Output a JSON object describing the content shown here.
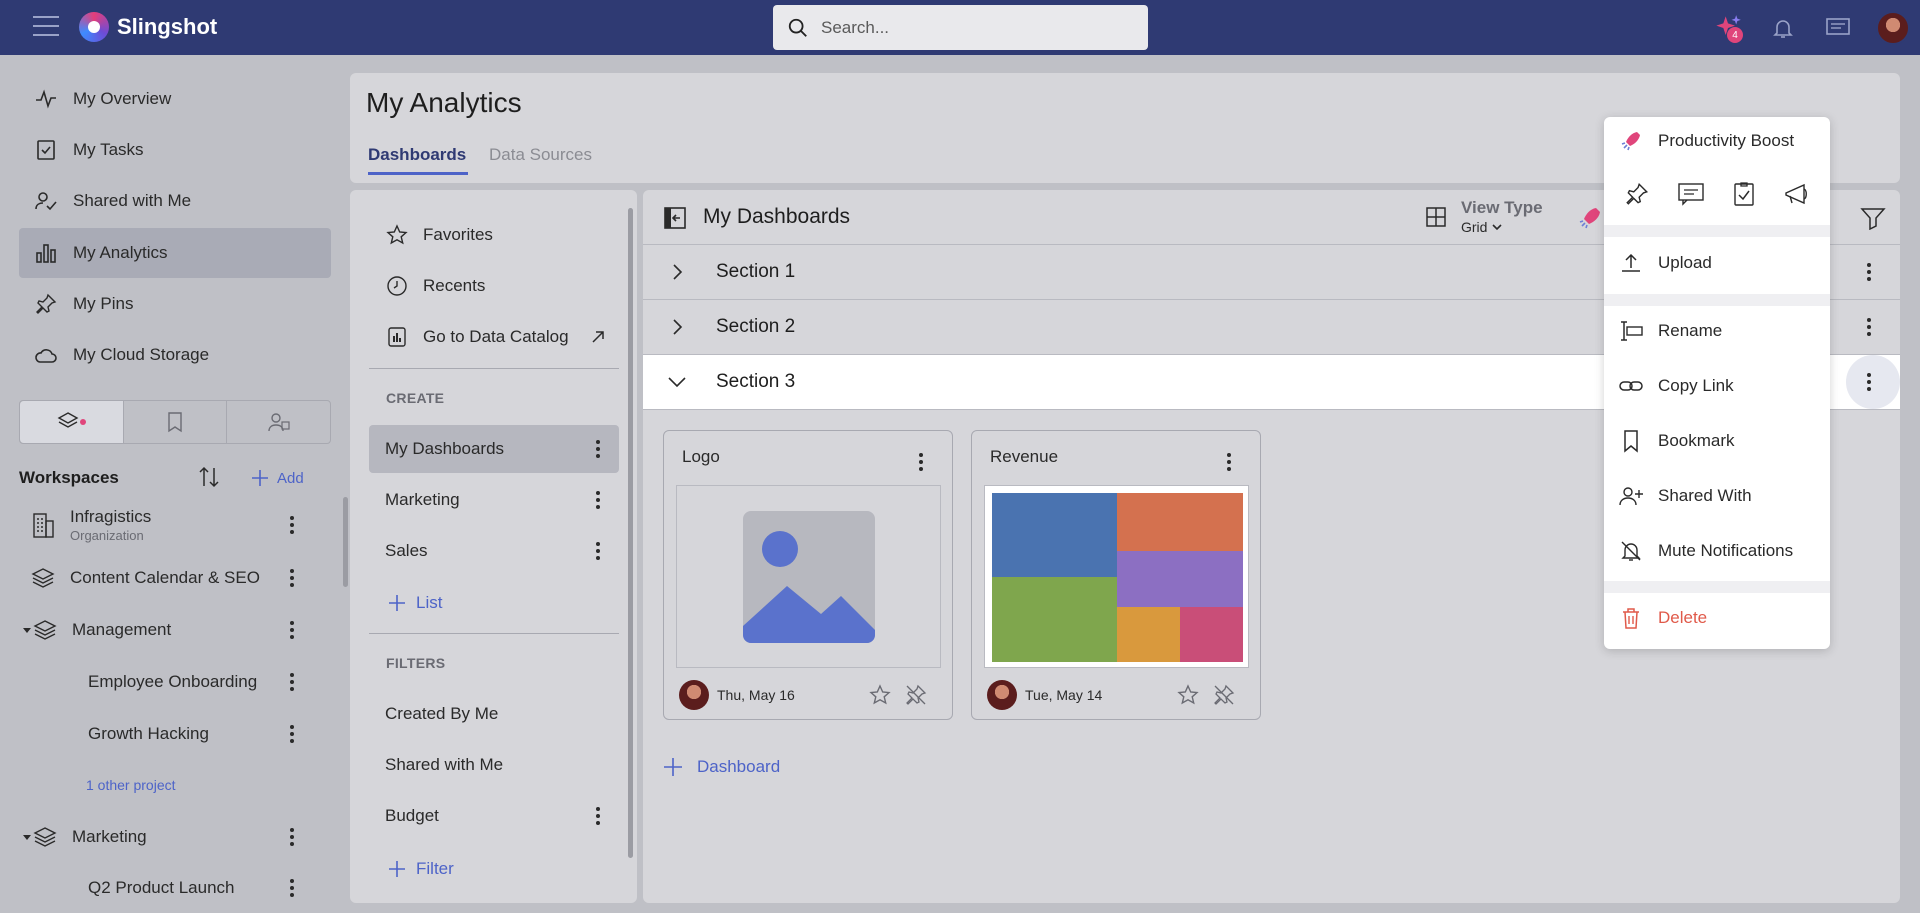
{
  "app": {
    "name": "Slingshot"
  },
  "search": {
    "placeholder": "Search..."
  },
  "topbar": {
    "ai_badge": "4"
  },
  "sidebar": {
    "items": [
      {
        "label": "My Overview"
      },
      {
        "label": "My Tasks"
      },
      {
        "label": "Shared with Me"
      },
      {
        "label": "My Analytics"
      },
      {
        "label": "My Pins"
      },
      {
        "label": "My Cloud Storage"
      }
    ],
    "workspaces_title": "Workspaces",
    "add_label": "Add",
    "workspaces": [
      {
        "label": "Infragistics",
        "sub": "Organization"
      },
      {
        "label": "Content Calendar & SEO"
      },
      {
        "label": "Management"
      },
      {
        "label": "Employee Onboarding"
      },
      {
        "label": "Growth Hacking"
      },
      {
        "label": "Marketing"
      },
      {
        "label": "Q2 Product Launch"
      }
    ],
    "other_projects": "1 other project"
  },
  "main": {
    "title": "My Analytics",
    "tabs": [
      {
        "label": "Dashboards"
      },
      {
        "label": "Data Sources"
      }
    ]
  },
  "panel": {
    "top": [
      {
        "label": "Favorites"
      },
      {
        "label": "Recents"
      },
      {
        "label": "Go to Data Catalog"
      }
    ],
    "create_label": "CREATE",
    "create": [
      {
        "label": "My Dashboards"
      },
      {
        "label": "Marketing"
      },
      {
        "label": "Sales"
      }
    ],
    "add_list": "List",
    "filters_label": "FILTERS",
    "filters": [
      {
        "label": "Created By Me"
      },
      {
        "label": "Shared with Me"
      },
      {
        "label": "Budget"
      }
    ],
    "add_filter": "Filter"
  },
  "dashboards": {
    "title": "My Dashboards",
    "view_type_label": "View Type",
    "view_type_value": "Grid",
    "sections": [
      {
        "label": "Section 1"
      },
      {
        "label": "Section 2"
      },
      {
        "label": "Section 3"
      }
    ],
    "cards": [
      {
        "name": "Logo",
        "date": "Thu, May 16"
      },
      {
        "name": "Revenue",
        "date": "Tue, May 14"
      }
    ],
    "add_dashboard": "Dashboard"
  },
  "menu": {
    "productivity": "Productivity Boost",
    "upload": "Upload",
    "rename": "Rename",
    "copy_link": "Copy Link",
    "bookmark": "Bookmark",
    "shared_with": "Shared With",
    "mute": "Mute Notifications",
    "delete": "Delete"
  },
  "colors": {
    "topbar": "#2f3a73",
    "accent": "#4d63c8",
    "danger": "#e05a4a",
    "treemap": [
      "#4a73b0",
      "#d4714f",
      "#8c6fc2",
      "#7fa64d",
      "#d9993d",
      "#c94e78"
    ]
  }
}
